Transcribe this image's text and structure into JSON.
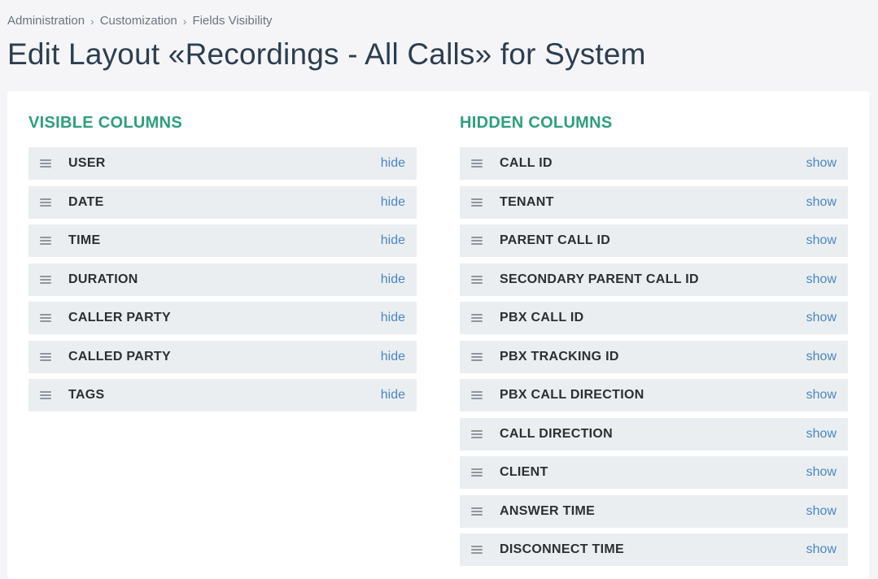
{
  "breadcrumb": {
    "items": [
      "Administration",
      "Customization",
      "Fields Visibility"
    ]
  },
  "page": {
    "title": "Edit Layout «Recordings - All Calls» for System"
  },
  "visible_columns": {
    "title": "VISIBLE COLUMNS",
    "action_label": "hide",
    "items": [
      {
        "label": "USER"
      },
      {
        "label": "DATE"
      },
      {
        "label": "TIME"
      },
      {
        "label": "DURATION"
      },
      {
        "label": "CALLER PARTY"
      },
      {
        "label": "CALLED PARTY"
      },
      {
        "label": "TAGS"
      }
    ]
  },
  "hidden_columns": {
    "title": "HIDDEN COLUMNS",
    "action_label": "show",
    "items": [
      {
        "label": "CALL ID"
      },
      {
        "label": "TENANT"
      },
      {
        "label": "PARENT CALL ID"
      },
      {
        "label": "SECONDARY PARENT CALL ID"
      },
      {
        "label": "PBX CALL ID"
      },
      {
        "label": "PBX TRACKING ID"
      },
      {
        "label": "PBX CALL DIRECTION"
      },
      {
        "label": "CALL DIRECTION"
      },
      {
        "label": "CLIENT"
      },
      {
        "label": "ANSWER TIME"
      },
      {
        "label": "DISCONNECT TIME"
      }
    ]
  },
  "colors": {
    "section_title": "#2e9e7e",
    "link": "#4a86c5",
    "row_background": "#ebeef0",
    "page_background": "#f5f5f7"
  },
  "icons": {
    "breadcrumb_separator": "chevron-right-icon",
    "row_handle": "drag-handle-icon"
  }
}
